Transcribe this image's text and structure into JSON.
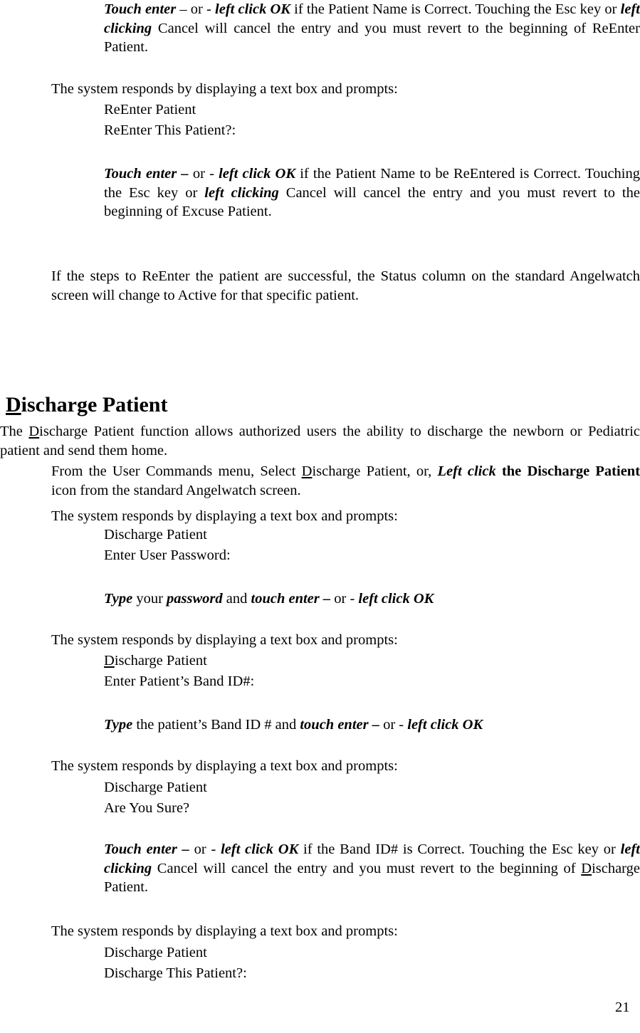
{
  "document": {
    "page_number": "21",
    "heading": {
      "underlined_first_letter": "D",
      "rest": "ischarge Patient"
    },
    "blocks": [
      {
        "id": "b1",
        "runs": [
          {
            "t": "Touch enter",
            "s": "bi"
          },
          {
            "t": " – or -  ",
            "s": ""
          },
          {
            "t": "left click OK",
            "s": "bi"
          },
          {
            "t": " if the Patient Name is Correct. Touching the Esc key or ",
            "s": ""
          },
          {
            "t": "left clicking",
            "s": "bi"
          },
          {
            "t": " Cancel  will cancel the entry and you must revert to the beginning of ReEnter Patient.",
            "s": ""
          }
        ]
      },
      {
        "id": "b2",
        "runs": [
          {
            "t": "The system responds by displaying a text box and prompts:",
            "s": ""
          }
        ]
      },
      {
        "id": "b3",
        "runs": [
          {
            "t": "ReEnter Patient",
            "s": ""
          }
        ]
      },
      {
        "id": "b4",
        "runs": [
          {
            "t": "ReEnter This Patient?:",
            "s": ""
          }
        ]
      },
      {
        "id": "b5",
        "runs": [
          {
            "t": "Touch enter –",
            "s": "bi"
          },
          {
            "t": " or -  ",
            "s": ""
          },
          {
            "t": "left click OK",
            "s": "bi"
          },
          {
            "t": " if the Patient Name to be ReEntered is Correct. Touching the Esc key or ",
            "s": ""
          },
          {
            "t": "left clicking",
            "s": "bi"
          },
          {
            "t": " Cancel  will cancel the entry and you must revert to the beginning of Excuse Patient.",
            "s": ""
          }
        ]
      },
      {
        "id": "b6",
        "runs": [
          {
            "t": "If the steps to ReEnter the patient are successful, the Status column on the standard Angelwatch screen will change to Active for that specific patient.",
            "s": ""
          }
        ]
      },
      {
        "id": "b7",
        "runs": [
          {
            "t": "   The ",
            "s": ""
          },
          {
            "t": "D",
            "s": "u"
          },
          {
            "t": "ischarge Patient function allows authorized users the ability to discharge the newborn or Pediatric patient and send them home.",
            "s": ""
          }
        ]
      },
      {
        "id": "b8",
        "runs": [
          {
            "t": "From the User Commands menu, Select ",
            "s": ""
          },
          {
            "t": "D",
            "s": "u"
          },
          {
            "t": "ischarge Patient, or, ",
            "s": ""
          },
          {
            "t": "Left click",
            "s": "bi"
          },
          {
            "t": " ",
            "s": ""
          },
          {
            "t": "the Discharge Patient",
            "s": "b"
          },
          {
            "t": " icon from the standard Angelwatch screen.",
            "s": ""
          }
        ]
      },
      {
        "id": "b9",
        "runs": [
          {
            "t": "The system responds by displaying a text box and prompts:",
            "s": ""
          }
        ]
      },
      {
        "id": "b10",
        "runs": [
          {
            "t": "Discharge Patient",
            "s": ""
          }
        ]
      },
      {
        "id": "b11",
        "runs": [
          {
            "t": "Enter User Password:",
            "s": ""
          }
        ]
      },
      {
        "id": "b12",
        "runs": [
          {
            "t": "Type",
            "s": "bi"
          },
          {
            "t": " your ",
            "s": ""
          },
          {
            "t": "password",
            "s": "bi"
          },
          {
            "t": " and ",
            "s": ""
          },
          {
            "t": "touch enter – ",
            "s": "bi"
          },
          {
            "t": "or -  ",
            "s": ""
          },
          {
            "t": "left click OK",
            "s": "bi"
          }
        ]
      },
      {
        "id": "b13",
        "runs": [
          {
            "t": "The system responds by displaying a text box and prompts:",
            "s": ""
          }
        ]
      },
      {
        "id": "b14",
        "runs": [
          {
            "t": "D",
            "s": "u"
          },
          {
            "t": "ischarge Patient",
            "s": ""
          }
        ]
      },
      {
        "id": "b15",
        "runs": [
          {
            "t": "Enter Patient’s Band ID#:",
            "s": ""
          }
        ]
      },
      {
        "id": "b16",
        "runs": [
          {
            "t": "Type",
            "s": "bi"
          },
          {
            "t": " the patient’s Band ID # and ",
            "s": ""
          },
          {
            "t": "touch enter – ",
            "s": "bi"
          },
          {
            "t": "or -  ",
            "s": ""
          },
          {
            "t": "left click OK",
            "s": "bi"
          }
        ]
      },
      {
        "id": "b17",
        "runs": [
          {
            "t": "The system responds by displaying a text box and prompts:",
            "s": ""
          }
        ]
      },
      {
        "id": "b18",
        "runs": [
          {
            "t": "Discharge Patient",
            "s": ""
          }
        ]
      },
      {
        "id": "b19",
        "runs": [
          {
            "t": "Are You Sure?",
            "s": ""
          }
        ]
      },
      {
        "id": "b20",
        "runs": [
          {
            "t": "Touch enter – ",
            "s": "bi"
          },
          {
            "t": "or -  ",
            "s": ""
          },
          {
            "t": "left click OK",
            "s": "bi"
          },
          {
            "t": " if the Band ID# is Correct. Touching the Esc key or ",
            "s": ""
          },
          {
            "t": "left clicking",
            "s": "bi"
          },
          {
            "t": " Cancel  will cancel the entry and you must revert to the beginning of ",
            "s": ""
          },
          {
            "t": "D",
            "s": "u"
          },
          {
            "t": "ischarge Patient.",
            "s": ""
          }
        ]
      },
      {
        "id": "b21",
        "runs": [
          {
            "t": "The system responds by displaying a text box and prompts:",
            "s": ""
          }
        ]
      },
      {
        "id": "b22",
        "runs": [
          {
            "t": "Discharge Patient",
            "s": ""
          }
        ]
      },
      {
        "id": "b23",
        "runs": [
          {
            "t": "Discharge This Patient?:",
            "s": ""
          }
        ]
      }
    ]
  }
}
